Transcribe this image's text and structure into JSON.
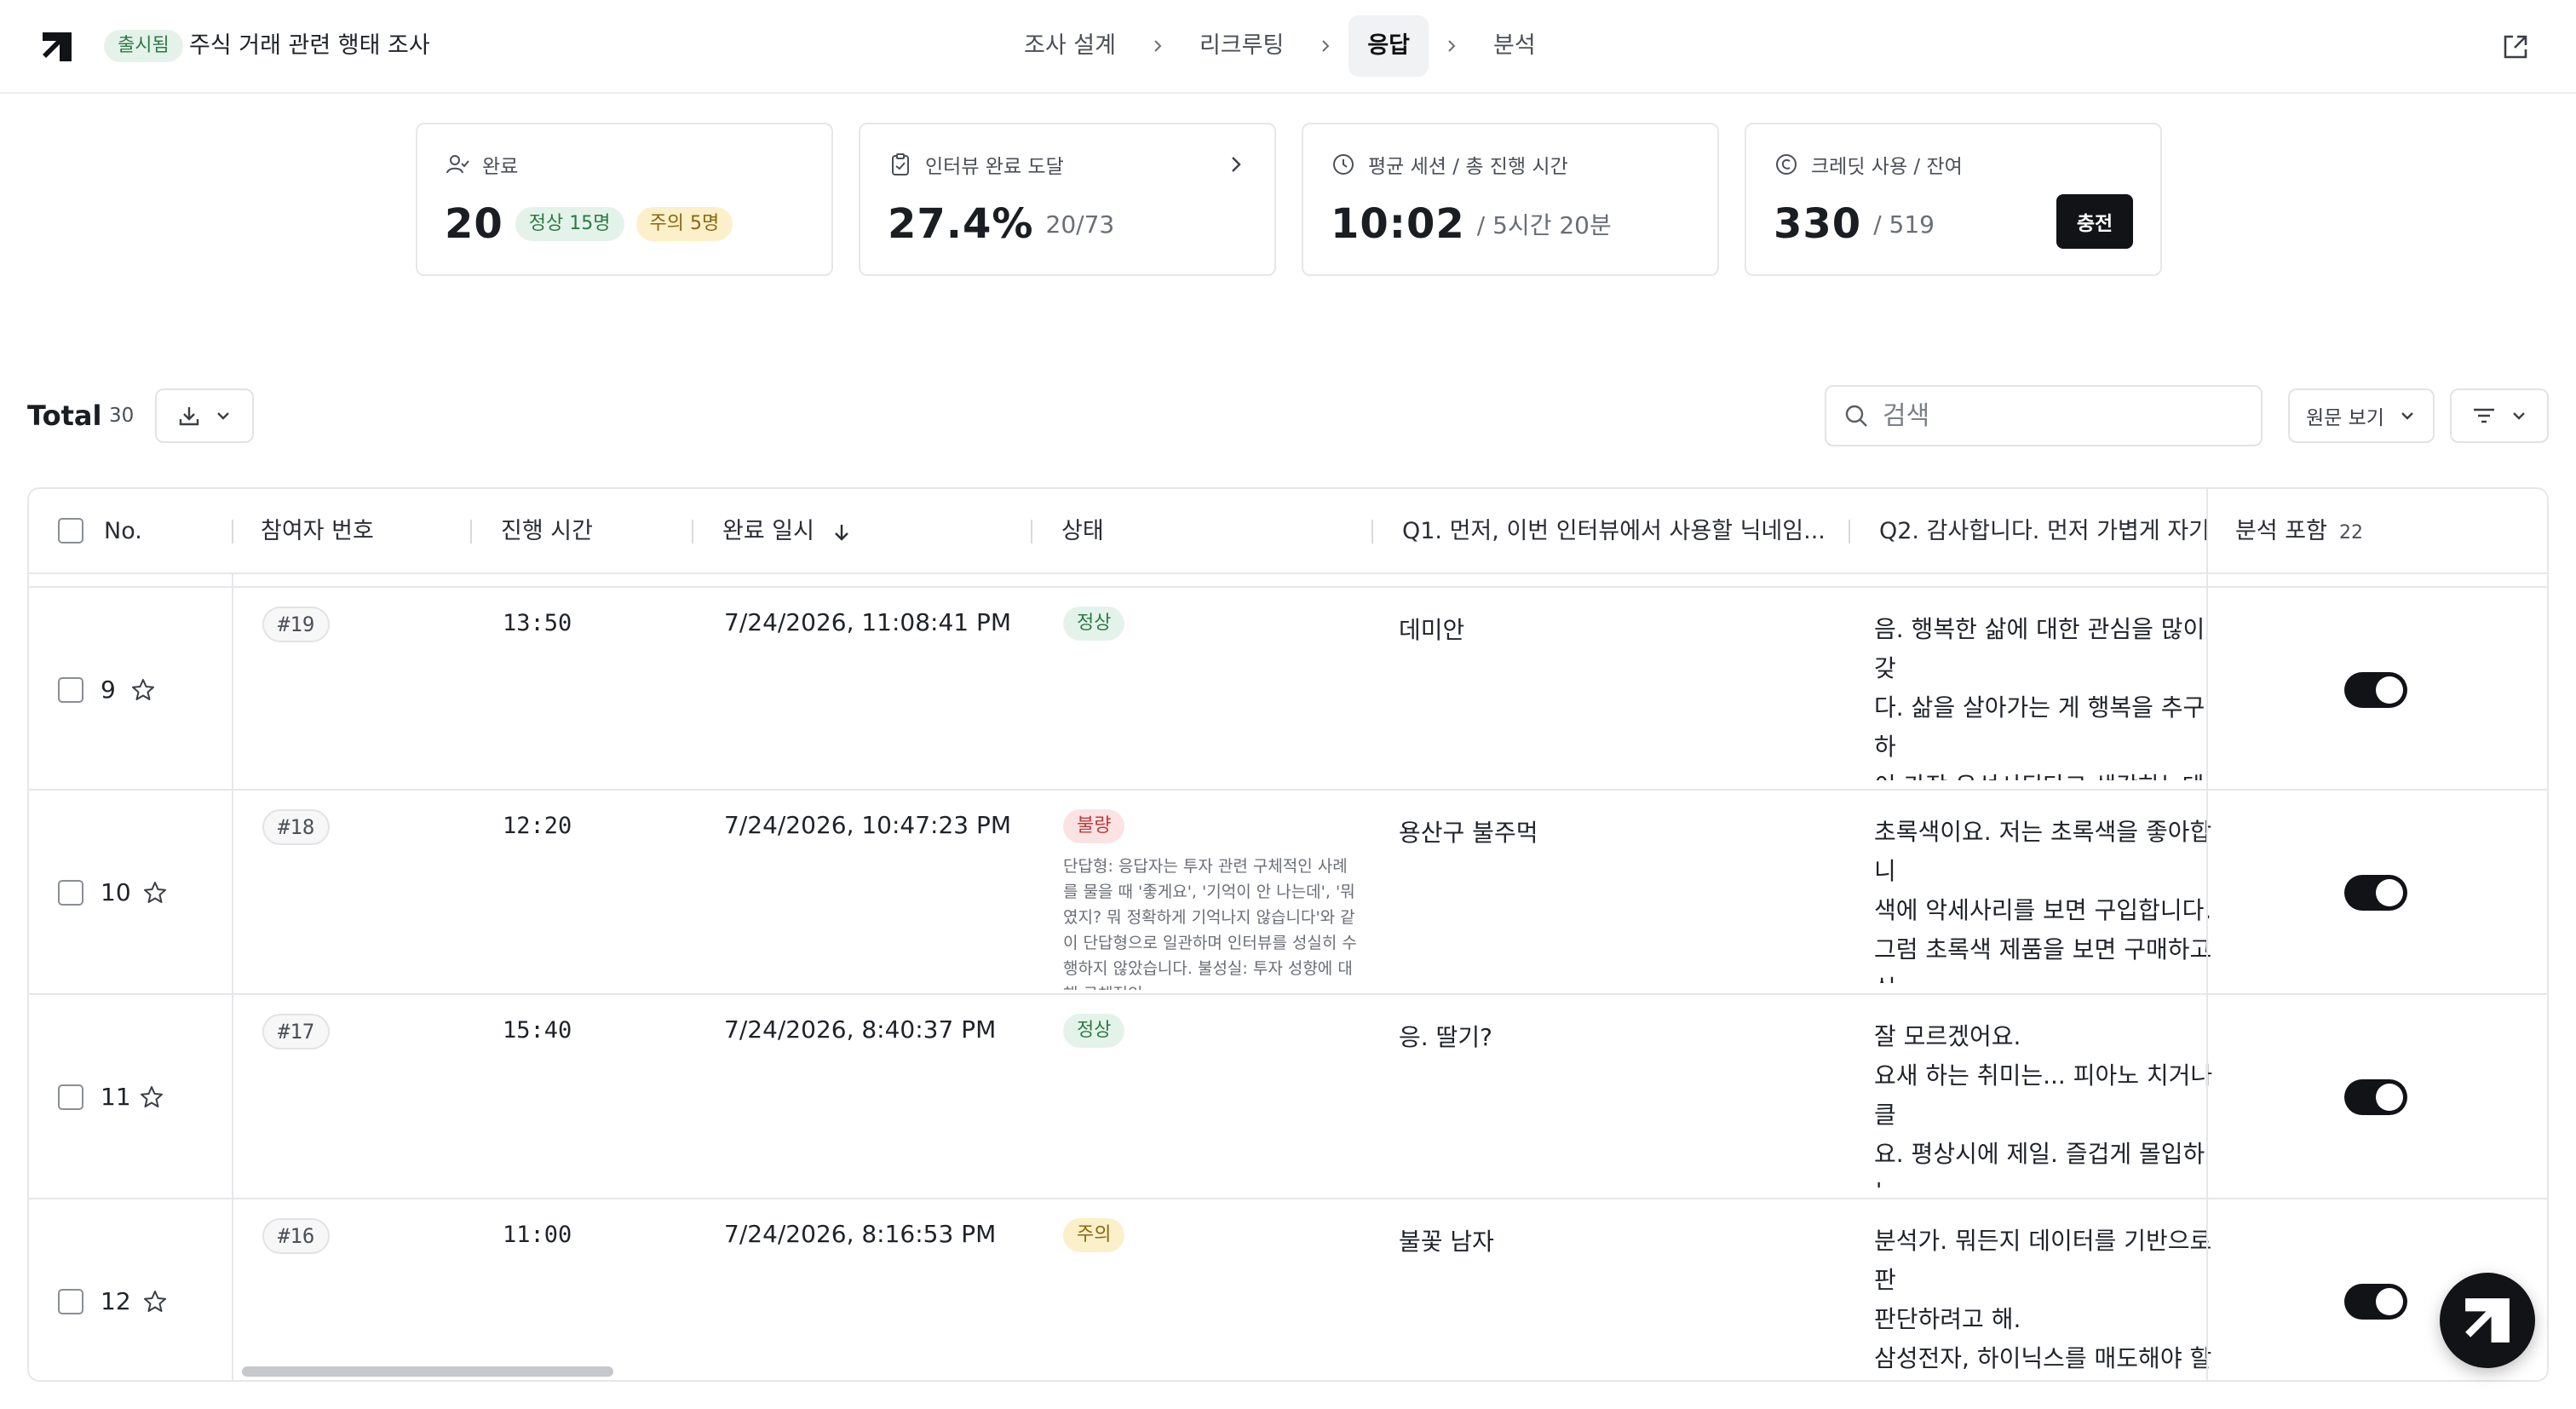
{
  "header": {
    "status_pill": "출시됨",
    "survey_title": "주식 거래 관련 행태 조사",
    "steps": [
      {
        "label": "조사 설계",
        "active": false
      },
      {
        "label": "리크루팅",
        "active": false
      },
      {
        "label": "응답",
        "active": true
      },
      {
        "label": "분석",
        "active": false
      }
    ]
  },
  "stats": {
    "completed": {
      "label": "완료",
      "value": "20",
      "normal": "정상 15명",
      "caution": "주의 5명"
    },
    "interview_rate": {
      "label": "인터뷰 완료 도달",
      "value": "27.4%",
      "sub": "20/73"
    },
    "session": {
      "label": "평균 세션 / 총 진행 시간",
      "value": "10:02",
      "sub": "/ 5시간 20분"
    },
    "credit": {
      "label": "크레딧 사용 / 잔여",
      "value": "330",
      "sub": "/ 519",
      "button": "충전"
    }
  },
  "toolbar": {
    "total_label": "Total",
    "total_count": "30",
    "search_placeholder": "검색",
    "view_label": "원문 보기"
  },
  "table": {
    "columns": {
      "no": "No.",
      "participant": "참여자 번호",
      "duration": "진행 시간",
      "completed_at": "완료 일시",
      "status": "상태",
      "q1": "Q1. 먼저, 이번 인터뷰에서 사용할 닉네임...",
      "q2": "Q2. 감사합니다. 먼저 가볍게 자기소",
      "include": "분석 포함",
      "include_count": "22"
    },
    "rows": [
      {
        "no": "9",
        "participant": "#19",
        "duration": "13:50",
        "completed_at": "7/24/2026, 11:08:41 PM",
        "status": "정상",
        "status_type": "ok",
        "reason": "",
        "q1": "데미안",
        "q2": "음. 행복한 삶에 대한 관심을 많이 갖\n다. 삶을 살아가는 게 행복을 추구하\n이 가장 우선시된다고 생각하는데, 우\n살아가면서 그 부분을 잘 염두에 두자",
        "included": true
      },
      {
        "no": "10",
        "participant": "#18",
        "duration": "12:20",
        "completed_at": "7/24/2026, 10:47:23 PM",
        "status": "불량",
        "status_type": "bad",
        "reason": "단답형: 응답자는 투자 관련 구체적인 사례를 물을 때 '좋게요', '기억이 안 나는데', '뭐였지? 뭐 정확하게 기억나지 않습니다'와 같이 단답형으로 일관하며 인터뷰를 성실히 수행하지 않았습니다. 불성실: 투자 성향에 대해 구체적인",
        "q1": "용산구 불주먹",
        "q2": "초록색이요. 저는 초록색을 좋아합니\n색에 악세사리를 보면 구입합니다.\n그럼 초록색 제품을 보면 구매하고 싶\n음, 외골수적인 측면? 하나에 빠지면",
        "included": true
      },
      {
        "no": "11",
        "participant": "#17",
        "duration": "15:40",
        "completed_at": "7/24/2026, 8:40:37 PM",
        "status": "정상",
        "status_type": "ok",
        "reason": "",
        "q1": "응. 딸기?",
        "q2": "잘 모르겠어요.\n요새 하는 취미는... 피아노 치거나 클\n요. 평상시에 제일. 즐겁게 몰입하는\n그. 순간인 것 같아요....",
        "included": true
      },
      {
        "no": "12",
        "participant": "#16",
        "duration": "11:00",
        "completed_at": "7/24/2026, 8:16:53 PM",
        "status": "주의",
        "status_type": "warn",
        "reason": "",
        "q1": "불꽃 남자",
        "q2": "분석가. 뭐든지 데이터를 기반으로 판\n판단하려고 해.\n삼성전자, 하이닉스를 매도해야 할지\n그 이해 시장 데이터와 시장 데이터",
        "included": true
      }
    ]
  }
}
